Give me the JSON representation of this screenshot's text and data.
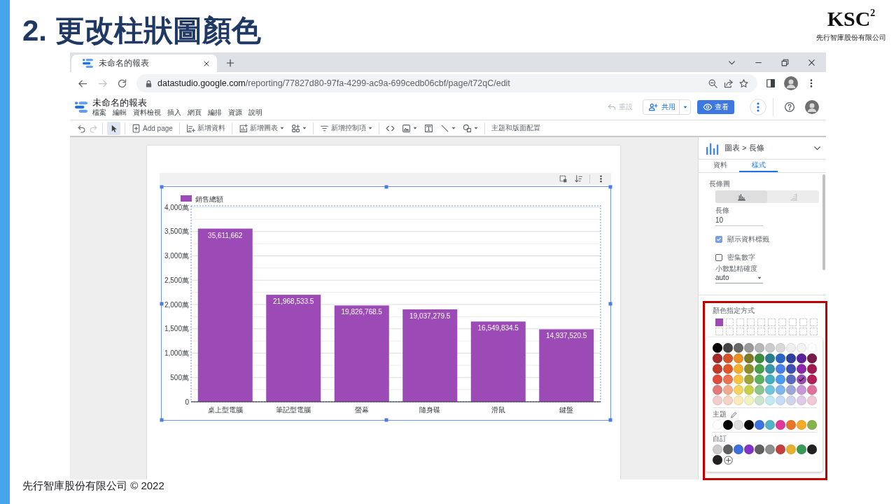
{
  "slide": {
    "title": "2. 更改柱狀圖顏色",
    "logo": {
      "mark": "KSC$^{2}$",
      "company": "先行智庫股份有限公司"
    },
    "footer": "先行智庫股份有限公司 © 2022"
  },
  "browser": {
    "tabs": [
      {
        "title": "未命名的報表",
        "selected": true
      }
    ],
    "nav": [
      {
        "kind": "back",
        "disabled": false
      },
      {
        "kind": "forward",
        "disabled": true
      },
      {
        "kind": "reload",
        "disabled": false
      }
    ],
    "url": {
      "host": "datastudio.google.com",
      "path": "/reporting/77827d80-97fa-4299-ac9a-699cedb06cbf/page/t72qC/edit"
    }
  },
  "app": {
    "title": "未命名的報表",
    "menu": [
      "檔案",
      "編輯",
      "資料檢視",
      "插入",
      "網頁",
      "編排",
      "資源",
      "說明"
    ],
    "reset": {
      "label": "重設",
      "disabled": true
    },
    "share": "共用",
    "view": "查看"
  },
  "toolbar": {
    "history": [
      {
        "kind": "undo",
        "disabled": false
      },
      {
        "kind": "redo",
        "disabled": true
      }
    ],
    "groups": [
      {
        "tools": [
          {
            "kind": "pointer",
            "selected": true,
            "dropdown": false
          }
        ]
      },
      {
        "tools": [
          {
            "kind": "add-page",
            "label": "Add page",
            "selected": false,
            "dropdown": false
          }
        ]
      },
      {
        "tools": [
          {
            "kind": "add-data",
            "label": "新增資料",
            "selected": false,
            "dropdown": false
          }
        ]
      },
      {
        "tools": [
          {
            "kind": "add-chart",
            "label": "新增圖表",
            "selected": false,
            "dropdown": true
          },
          {
            "kind": "components",
            "selected": false,
            "dropdown": true
          }
        ]
      },
      {
        "tools": [
          {
            "kind": "add-control",
            "label": "新增控制項",
            "selected": false,
            "dropdown": true
          }
        ]
      },
      {
        "tools": [
          {
            "kind": "code",
            "selected": false,
            "dropdown": false
          },
          {
            "kind": "image",
            "selected": false,
            "dropdown": true
          },
          {
            "kind": "text",
            "selected": false,
            "dropdown": false
          },
          {
            "kind": "line",
            "selected": false,
            "dropdown": true
          },
          {
            "kind": "shape",
            "selected": false,
            "dropdown": true
          }
        ]
      },
      {
        "tools": [
          {
            "kind": "theme",
            "label": "主題和版面配置",
            "selected": false,
            "dropdown": false
          }
        ]
      }
    ]
  },
  "chart": {
    "chart_data": {
      "type": "bar",
      "categories": [
        "桌上型電腦",
        "筆記型電腦",
        "螢幕",
        "隨身碟",
        "滑鼠",
        "鍵盤"
      ],
      "series": [
        {
          "name": "銷售總額",
          "color": "#9b4ab6",
          "values": [
            3560,
            2200,
            1980,
            1900,
            1650,
            1490
          ]
        }
      ],
      "ylim": [
        0,
        4000
      ],
      "yticks": [
        {
          "value": 0,
          "label": "0"
        },
        {
          "value": 500,
          "label": "500萬"
        },
        {
          "value": 1000,
          "label": "1,000萬"
        },
        {
          "value": 1500,
          "label": "1,500萬"
        },
        {
          "value": 2000,
          "label": "2,000萬"
        },
        {
          "value": 2500,
          "label": "2,500萬"
        },
        {
          "value": 3000,
          "label": "3,000萬"
        },
        {
          "value": 3500,
          "label": "3,500萬"
        },
        {
          "value": 4000,
          "label": "4,000萬"
        }
      ],
      "grid": true,
      "value_labels": [
        "35,611,662",
        "21,968,533.5",
        "19,826,768.5",
        "19,037,279.5",
        "16,549,834.5",
        "14,937,520.5"
      ]
    }
  },
  "panel": {
    "title": "圖表 > 長條",
    "tabs": [
      {
        "label": "資料",
        "selected": false
      },
      {
        "label": "樣式",
        "selected": true
      }
    ],
    "section": "長條圖",
    "orientation": [
      {
        "kind": "vertical",
        "selected": true
      },
      {
        "kind": "horizontal",
        "selected": false
      }
    ],
    "bars": {
      "label": "長條",
      "value": "10"
    },
    "options": [
      {
        "label": "顯示資料標籤",
        "checked": true
      },
      {
        "label": "密集數字",
        "checked": false
      }
    ],
    "precision": {
      "label": "小數點精確度",
      "value": "auto"
    },
    "color": {
      "label": "顏色指定方式",
      "series": [
        {
          "color": "#9b4ab6"
        }
      ]
    }
  },
  "picker": {
    "palette": [
      {
        "color": "#000000",
        "selected": false
      },
      {
        "color": "#434343",
        "selected": false
      },
      {
        "color": "#666666",
        "selected": false
      },
      {
        "color": "#999999",
        "selected": false
      },
      {
        "color": "#b7b7b7",
        "selected": false
      },
      {
        "color": "#cccccc",
        "selected": false
      },
      {
        "color": "#d9d9d9",
        "selected": false
      },
      {
        "color": "#efefef",
        "selected": false
      },
      {
        "color": "#f3f3f3",
        "selected": false
      },
      {
        "color": "#ffffff",
        "selected": false
      },
      {
        "color": "#a52a2a",
        "selected": false
      },
      {
        "color": "#d4532a",
        "selected": false
      },
      {
        "color": "#ea9022",
        "selected": false
      },
      {
        "color": "#7d7b26",
        "selected": false
      },
      {
        "color": "#3c8d40",
        "selected": false
      },
      {
        "color": "#2a7d8e",
        "selected": false
      },
      {
        "color": "#2b64c2",
        "selected": false
      },
      {
        "color": "#2f3f9e",
        "selected": false
      },
      {
        "color": "#5b2299",
        "selected": false
      },
      {
        "color": "#7a1a48",
        "selected": false
      },
      {
        "color": "#c0392b",
        "selected": false
      },
      {
        "color": "#e0572a",
        "selected": false
      },
      {
        "color": "#f2b02e",
        "selected": false
      },
      {
        "color": "#8e8d2b",
        "selected": false
      },
      {
        "color": "#4aa14c",
        "selected": false
      },
      {
        "color": "#3a97a6",
        "selected": false
      },
      {
        "color": "#4a80e6",
        "selected": false
      },
      {
        "color": "#3d4fb0",
        "selected": false
      },
      {
        "color": "#8a2aa8",
        "selected": false
      },
      {
        "color": "#a01a50",
        "selected": false
      },
      {
        "color": "#e04c3c",
        "selected": false
      },
      {
        "color": "#ee7150",
        "selected": false
      },
      {
        "color": "#f6c443",
        "selected": false
      },
      {
        "color": "#9fa53a",
        "selected": false
      },
      {
        "color": "#5cb35e",
        "selected": false
      },
      {
        "color": "#45aec0",
        "selected": false
      },
      {
        "color": "#4b9bf0",
        "selected": false
      },
      {
        "color": "#5b6abf",
        "selected": false
      },
      {
        "color": "#9b4ab6",
        "selected": true
      },
      {
        "color": "#b31f56",
        "selected": false
      },
      {
        "color": "#e07b7b",
        "selected": false
      },
      {
        "color": "#f2a98f",
        "selected": false
      },
      {
        "color": "#f6d35c",
        "selected": false
      },
      {
        "color": "#c7d046",
        "selected": false
      },
      {
        "color": "#8cc68c",
        "selected": false
      },
      {
        "color": "#6fc7d8",
        "selected": false
      },
      {
        "color": "#80b6f0",
        "selected": false
      },
      {
        "color": "#9ea7d8",
        "selected": false
      },
      {
        "color": "#c796d8",
        "selected": false
      },
      {
        "color": "#e0719a",
        "selected": false
      },
      {
        "color": "#f4cccc",
        "selected": false
      },
      {
        "color": "#f7d3c4",
        "selected": false
      },
      {
        "color": "#fbeab9",
        "selected": false
      },
      {
        "color": "#f1f2c2",
        "selected": false
      },
      {
        "color": "#cde5cc",
        "selected": false
      },
      {
        "color": "#c2e8f0",
        "selected": false
      },
      {
        "color": "#c9dcf7",
        "selected": false
      },
      {
        "color": "#d1d5ec",
        "selected": false
      },
      {
        "color": "#e1cae9",
        "selected": false
      },
      {
        "color": "#f1c9d6",
        "selected": false
      }
    ],
    "theme": {
      "label": "主題",
      "swatches": [
        {
          "color": "#ffffff",
          "selected": false
        },
        {
          "color": "#000000",
          "selected": false
        },
        {
          "color": "#e0e0e0",
          "selected": false
        },
        {
          "color": "#000000",
          "selected": false
        },
        {
          "color": "#3b73e3",
          "selected": false
        },
        {
          "color": "#52b4c9",
          "selected": false
        },
        {
          "color": "#e0399a",
          "selected": false
        },
        {
          "color": "#e8752a",
          "selected": false
        },
        {
          "color": "#f4ab2b",
          "selected": false
        },
        {
          "color": "#86b24c",
          "selected": false
        }
      ]
    },
    "custom": {
      "label": "自訂",
      "swatches": [
        {
          "color": "#cccccc",
          "selected": false
        },
        {
          "color": "#5f5f5f",
          "selected": false
        },
        {
          "color": "#3d6fe0",
          "selected": false
        },
        {
          "color": "#8234c8",
          "selected": false
        },
        {
          "color": "#606060",
          "selected": false
        },
        {
          "color": "#8f8f8f",
          "selected": false
        },
        {
          "color": "#c44040",
          "selected": false
        },
        {
          "color": "#e8b030",
          "selected": false
        },
        {
          "color": "#3a9a5a",
          "selected": false
        },
        {
          "color": "#222222",
          "selected": false
        },
        {
          "color": "#222222",
          "selected": false
        }
      ]
    }
  }
}
